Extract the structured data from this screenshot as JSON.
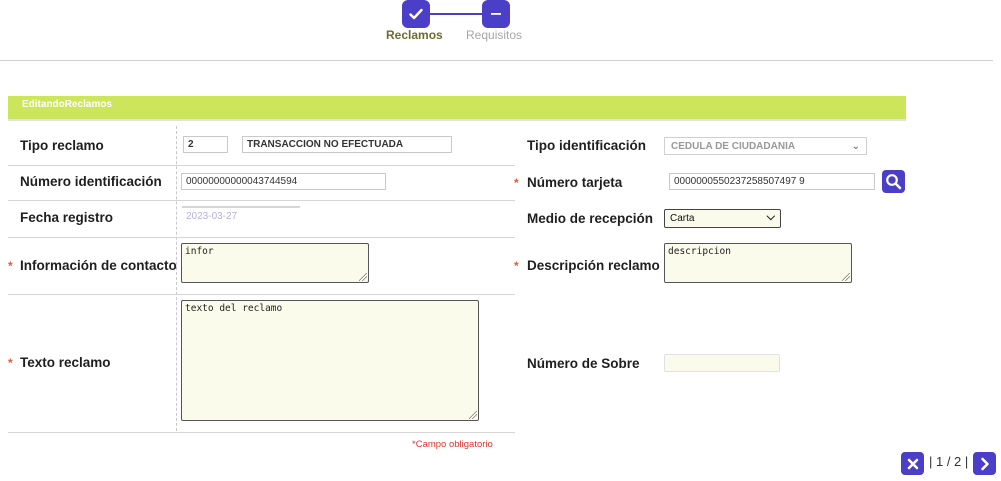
{
  "stepper": {
    "steps": [
      {
        "label": "Reclamos",
        "icon": "check-icon",
        "state": "active"
      },
      {
        "label": "Requisitos",
        "icon": "minus-icon",
        "state": "inactive"
      }
    ]
  },
  "form": {
    "header": "EditandoReclamos",
    "left": {
      "tipo_reclamo": {
        "label": "Tipo reclamo",
        "code": "2",
        "description": "TRANSACCION NO EFECTUADA"
      },
      "numero_identificacion": {
        "label": "Número identificación",
        "value": "00000000000043744594"
      },
      "fecha_registro": {
        "label": "Fecha registro",
        "value": "2023-03-27"
      },
      "informacion_contacto": {
        "label": "Información de contacto",
        "value": "infor",
        "required": true
      },
      "texto_reclamo": {
        "label": "Texto reclamo",
        "value": "texto del reclamo",
        "required": true
      }
    },
    "right": {
      "tipo_identificacion": {
        "label": "Tipo identificación",
        "value": "CEDULA DE CIUDADANIA"
      },
      "numero_tarjeta": {
        "label": "Número tarjeta",
        "value": "0000000550237258507497 9",
        "required": true
      },
      "medio_recepcion": {
        "label": "Medio de recepción",
        "value": "Carta"
      },
      "descripcion_reclamo": {
        "label": "Descripción reclamo",
        "value": "descripcion",
        "required": true
      },
      "numero_sobre": {
        "label": "Número de Sobre",
        "value": ""
      }
    },
    "required_mark": "*",
    "required_note": "Campo obligatorio"
  },
  "pager": {
    "text": "| 1 / 2 |"
  },
  "colors": {
    "accent": "#4a3fc6",
    "header_bar": "#cde55b",
    "required": "#e25b3a"
  }
}
